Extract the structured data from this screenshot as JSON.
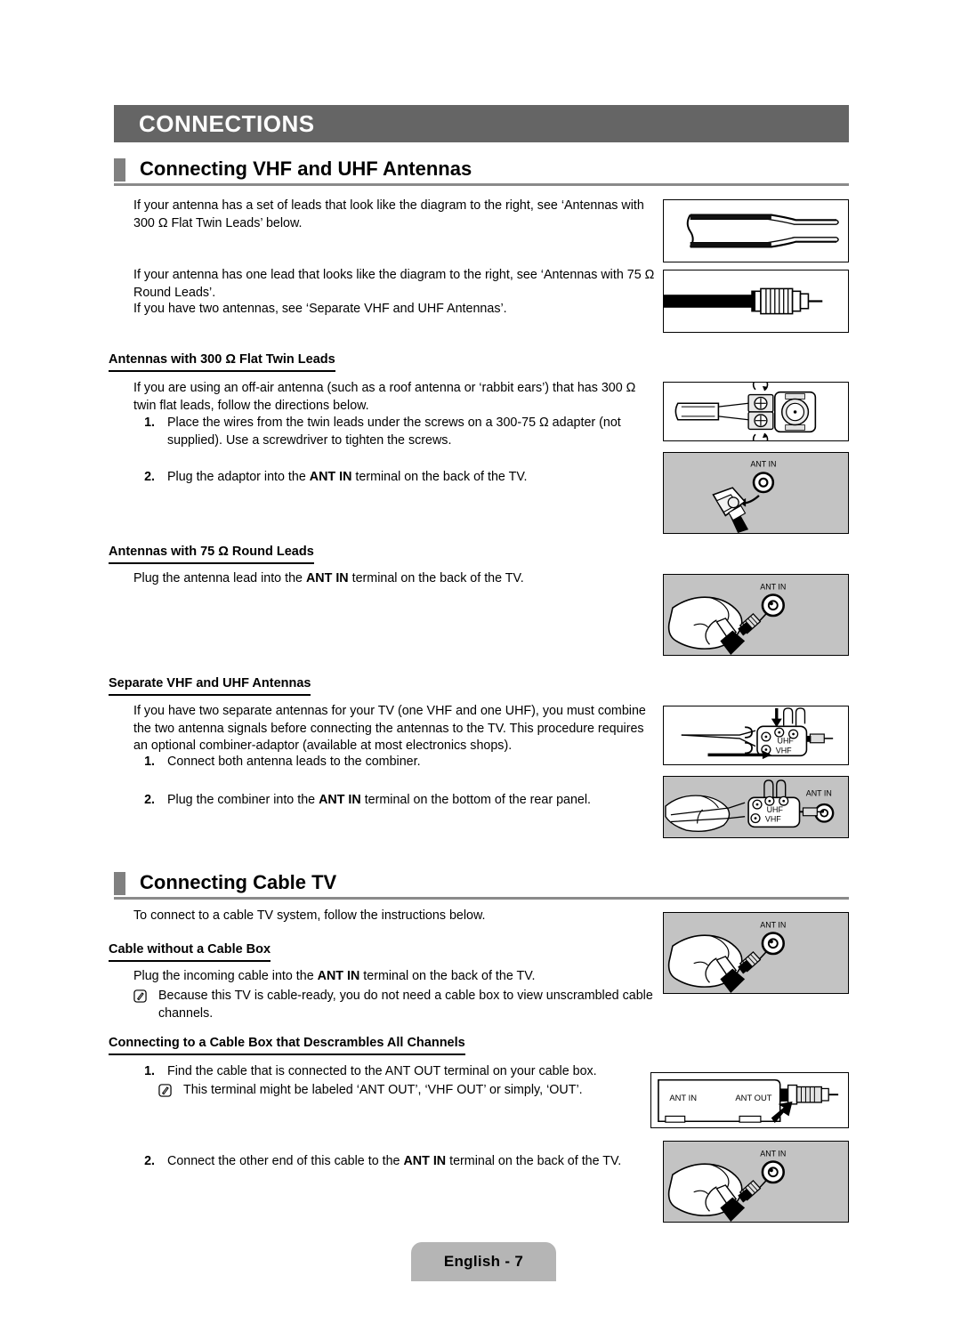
{
  "chapter": {
    "title": "CONNECTIONS"
  },
  "sections": [
    {
      "title": "Connecting VHF and UHF Antennas"
    },
    {
      "title": "Connecting Cable TV"
    }
  ],
  "intro": {
    "p1_line1": "If your antenna has a set of leads that look like the diagram to the right, see ‘Antennas with",
    "p1_line2": "300 Ω Flat Twin Leads’ below.",
    "p2_line1": "If your antenna has one lead that looks like the diagram to the right, see ‘Antennas with 75 Ω",
    "p2_line2": "Round Leads’.",
    "p2_line3": "If you have two antennas, see ‘Separate VHF and UHF Antennas’."
  },
  "flat_twin": {
    "heading": "Antennas with 300 Ω Flat Twin Leads",
    "body_line1": "If you are using an off-air antenna (such as a roof antenna or ‘rabbit ears’) that has 300 Ω twin",
    "body_line2": "flat leads, follow the directions below.",
    "step1_num": "1.",
    "step1_line1": "Place the wires from the twin leads under the screws on a 300-75 Ω adapter (not",
    "step1_line2": "supplied). Use a screwdriver to tighten the screws.",
    "step2_num": "2.",
    "step2_a": "Plug the adaptor into the ",
    "step2_b": "ANT IN",
    "step2_c": " terminal on the back of the TV."
  },
  "round_leads": {
    "heading": "Antennas with 75 Ω Round Leads",
    "body_a": "Plug the antenna lead into the ",
    "body_b": "ANT IN",
    "body_c": " terminal on the back of the TV."
  },
  "separate": {
    "heading": "Separate VHF and UHF Antennas",
    "body_line1": "If you have two separate antennas for your TV (one VHF and one UHF), you must combine",
    "body_line2": "the two antenna signals before connecting the antennas to the TV. This procedure requires an",
    "body_line3": "optional combiner-adaptor (available at most electronics shops).",
    "step1_num": "1.",
    "step1_text": "Connect both antenna leads to the combiner.",
    "step2_num": "2.",
    "step2_a": "Plug the combiner into the ",
    "step2_b": "ANT IN",
    "step2_c": " terminal on the bottom of the rear panel."
  },
  "cable_tv": {
    "intro": "To connect to a cable TV system, follow the instructions below."
  },
  "no_box": {
    "heading": "Cable without a Cable Box",
    "body_a": "Plug the incoming cable into the ",
    "body_b": "ANT IN",
    "body_c": " terminal on the back of the TV.",
    "note_line1": "Because this TV is cable-ready, you do not need a cable box to view unscrambled cable",
    "note_line2": "channels."
  },
  "descramble": {
    "heading": "Connecting to a Cable Box that Descrambles All Channels",
    "step1_num": "1.",
    "step1_text": "Find the cable that is connected to the ANT OUT terminal on your cable box.",
    "note_text": "This terminal might be labeled ‘ANT OUT’, ‘VHF OUT’ or simply, ‘OUT’.",
    "step2_num": "2.",
    "step2_a": "Connect the other end of this cable to the ",
    "step2_b": "ANT IN",
    "step2_c": " terminal on the back of the TV."
  },
  "illustrations": {
    "flat_twin_cable": {
      "name": "flat-twin-lead-cable-diagram"
    },
    "coax_cable": {
      "name": "coaxial-round-lead-cable-diagram"
    },
    "adapter": {
      "name": "300-75-ohm-adapter-diagram"
    },
    "adapter_into_ant_in": {
      "name": "adapter-into-ant-in-diagram",
      "label": "ANT IN"
    },
    "hand_round_lead": {
      "name": "hand-plugging-coax-into-ant-in-diagram",
      "label": "ANT IN"
    },
    "combiner": {
      "name": "combiner-adaptor-diagram",
      "label_uhf": "UHF",
      "label_vhf": "VHF"
    },
    "combiner_into_tv": {
      "name": "combiner-into-ant-in-diagram",
      "label_uhf": "UHF",
      "label_vhf": "VHF",
      "label_ant_in": "ANT IN"
    },
    "cable_no_box": {
      "name": "hand-plugging-cable-into-ant-in-diagram",
      "label": "ANT IN"
    },
    "cable_box": {
      "name": "cable-box-rear-panel-diagram",
      "label_ant_in": "ANT IN",
      "label_ant_out": "ANT OUT"
    },
    "cable_box_to_tv": {
      "name": "hand-plugging-cable-into-tv-ant-in-diagram",
      "label": "ANT IN"
    }
  },
  "footer": {
    "page_label": "English - 7"
  }
}
